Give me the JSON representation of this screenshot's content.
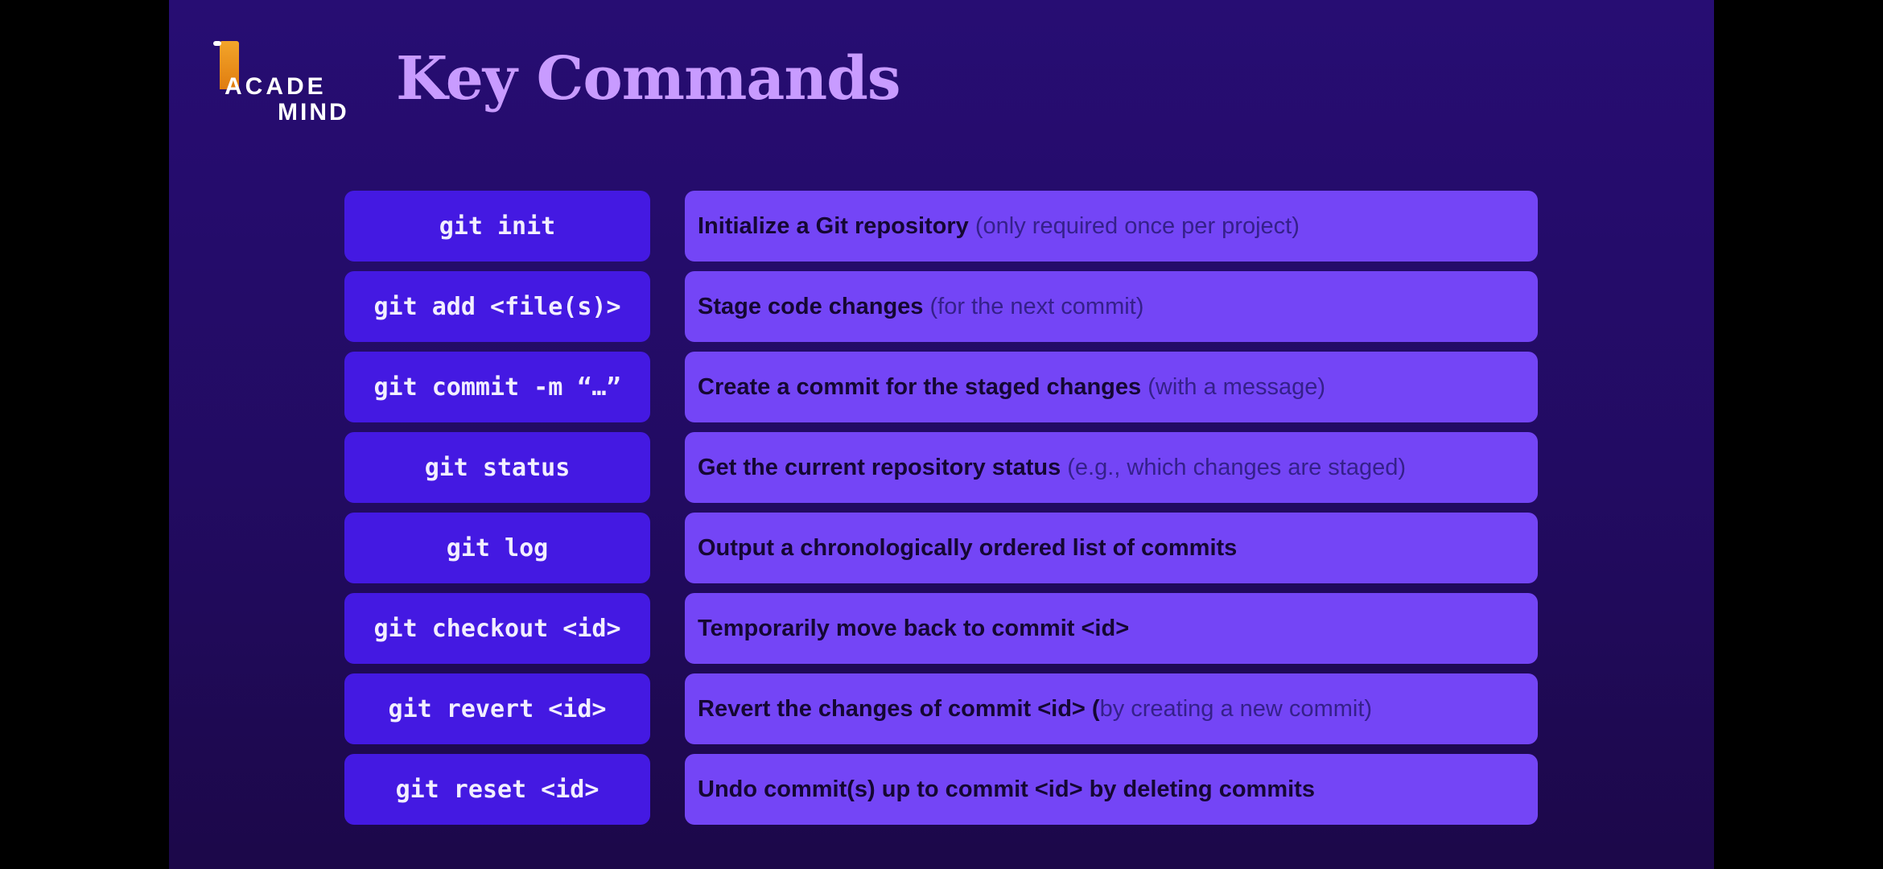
{
  "logo": {
    "line1": "ACADE",
    "line2": "MIND"
  },
  "title": "Key Commands",
  "rows": [
    {
      "command": "git init",
      "bold": "Initialize a Git repository",
      "note": " (only required once per project)"
    },
    {
      "command": "git add <file(s)>",
      "bold": "Stage code changes",
      "note": " (for the next commit)"
    },
    {
      "command": "git commit -m “…”",
      "bold": "Create a commit for the staged changes",
      "note": " (with a message)"
    },
    {
      "command": "git status",
      "bold": "Get the current repository status",
      "note": " (e.g., which changes are staged)"
    },
    {
      "command": "git log",
      "bold": "Output a chronologically ordered list of commits",
      "note": ""
    },
    {
      "command": "git checkout <id>",
      "bold": "Temporarily move back to commit <id>",
      "note": ""
    },
    {
      "command": "git revert <id>",
      "bold": "Revert the changes of commit <id> (",
      "note": "by creating a new commit)"
    },
    {
      "command": "git reset <id>",
      "bold": "Undo commit(s) up to commit <id> by deleting commits",
      "note": ""
    }
  ]
}
